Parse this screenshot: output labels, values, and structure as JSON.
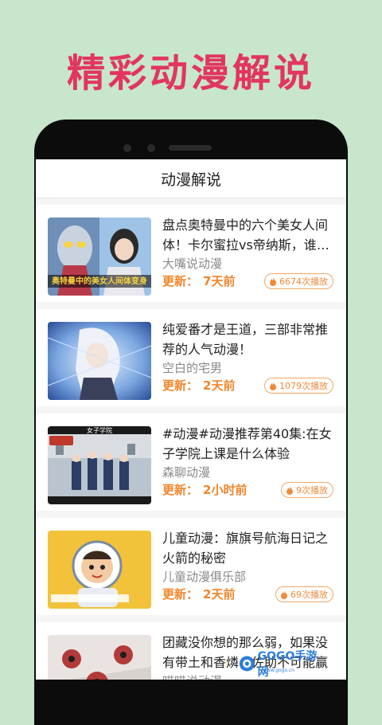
{
  "promo": {
    "title": "精彩动漫解说"
  },
  "app": {
    "header_title": "动漫解说"
  },
  "labels": {
    "update_prefix": "更新："
  },
  "colors": {
    "accent": "#f2852b",
    "promo_title": "#e23560",
    "background": "#c8e6cc"
  },
  "items": [
    {
      "title": "盘点奥特曼中的六个美女人间体！卡尔蜜拉vs帝纳斯，谁最…",
      "author": "大嘴说动漫",
      "updated": "7天前",
      "plays": "6674次播放",
      "thumb_caption": "奥特曼中的美女人间体变身"
    },
    {
      "title": "纯爱番才是王道，三部非常推荐的人气动漫！",
      "author": "空白的宅男",
      "updated": "2天前",
      "plays": "1079次播放"
    },
    {
      "title": "#动漫#动漫推荐第40集:在女子学院上课是什么体验",
      "author": "森聊动漫",
      "updated": "2小时前",
      "plays": "9次播放",
      "thumb_caption": "女子学院"
    },
    {
      "title": "儿童动漫：旗旗号航海日记之火箭的秘密",
      "author": "儿童动漫俱乐部",
      "updated": "2天前",
      "plays": "69次播放"
    },
    {
      "title": "团藏没你想的那么弱，如果没有带土和香燐，佐助不可能赢",
      "author": "喵喵说动漫",
      "updated": "",
      "plays": ""
    }
  ],
  "watermark": {
    "text": "GOGO手游网",
    "sub": "www.gogo.cn"
  }
}
